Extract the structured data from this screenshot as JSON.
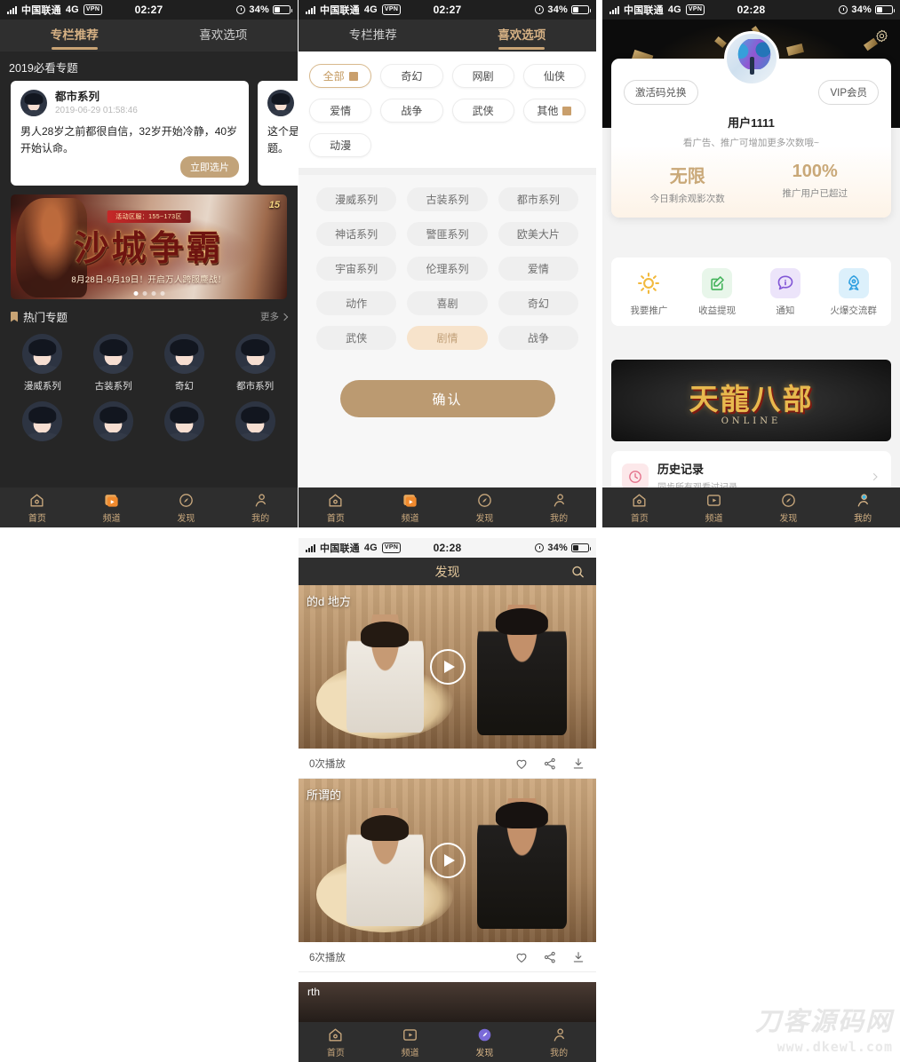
{
  "watermark": {
    "cn": "刀客源码网",
    "en": "www.dkewl.com"
  },
  "phone1": {
    "status": {
      "carrier": "中国联通",
      "network": "4G",
      "vpn": "VPN",
      "time": "02:27",
      "battery": "34%"
    },
    "tabs": [
      {
        "label": "专栏推荐",
        "active": true
      },
      {
        "label": "喜欢选项",
        "active": false
      }
    ],
    "section_title": "2019必看专题",
    "cards": [
      {
        "name": "都市系列",
        "time": "2019-06-29 01:58:46",
        "desc": "男人28岁之前都很自信，32岁开始冷静，40岁开始认命。",
        "button": "立即选片"
      },
      {
        "name": "",
        "time": "",
        "desc": "这个是专题。",
        "button": ""
      }
    ],
    "banner": {
      "tagline": "活动区服：155~173区",
      "title": "沙城争霸",
      "subtitle": "8月28日-9月19日！开启万人跨服鏖战！",
      "logo": "15"
    },
    "hot": {
      "title": "热门专题",
      "more": "更多",
      "items": [
        {
          "label": "漫威系列"
        },
        {
          "label": "古装系列"
        },
        {
          "label": "奇幻"
        },
        {
          "label": "都市系列"
        },
        {
          "label": ""
        },
        {
          "label": ""
        },
        {
          "label": ""
        },
        {
          "label": ""
        }
      ]
    },
    "nav": [
      {
        "label": "首页",
        "icon": "home-icon",
        "active": true
      },
      {
        "label": "频道",
        "icon": "channel-icon",
        "active": false
      },
      {
        "label": "发现",
        "icon": "compass-icon",
        "active": false
      },
      {
        "label": "我的",
        "icon": "person-icon",
        "active": false
      }
    ]
  },
  "phone2": {
    "status": {
      "carrier": "中国联通",
      "network": "4G",
      "vpn": "VPN",
      "time": "02:27",
      "battery": "34%"
    },
    "tabs": [
      {
        "label": "专栏推荐",
        "active": false
      },
      {
        "label": "喜欢选项",
        "active": true
      }
    ],
    "top_pills": [
      {
        "label": "全部",
        "selected": true,
        "swatch": true
      },
      {
        "label": "奇幻",
        "selected": false,
        "swatch": false
      },
      {
        "label": "网剧",
        "selected": false,
        "swatch": false
      },
      {
        "label": "仙侠",
        "selected": false,
        "swatch": false
      },
      {
        "label": "爱情",
        "selected": false,
        "swatch": false
      },
      {
        "label": "战争",
        "selected": false,
        "swatch": false
      },
      {
        "label": "武侠",
        "selected": false,
        "swatch": false
      },
      {
        "label": "其他",
        "selected": false,
        "swatch": true
      },
      {
        "label": "动漫",
        "selected": false,
        "swatch": false
      }
    ],
    "tag_pills": [
      {
        "label": "漫威系列",
        "selected": false
      },
      {
        "label": "古装系列",
        "selected": false
      },
      {
        "label": "都市系列",
        "selected": false
      },
      {
        "label": "神话系列",
        "selected": false
      },
      {
        "label": "警匪系列",
        "selected": false
      },
      {
        "label": "欧美大片",
        "selected": false
      },
      {
        "label": "宇宙系列",
        "selected": false
      },
      {
        "label": "伦理系列",
        "selected": false
      },
      {
        "label": "爱情",
        "selected": false
      },
      {
        "label": "动作",
        "selected": false
      },
      {
        "label": "喜剧",
        "selected": false
      },
      {
        "label": "奇幻",
        "selected": false
      },
      {
        "label": "武侠",
        "selected": false
      },
      {
        "label": "剧情",
        "selected": true
      },
      {
        "label": "战争",
        "selected": false
      }
    ],
    "confirm_label": "确认",
    "nav": [
      {
        "label": "首页",
        "icon": "home-icon",
        "active": true
      },
      {
        "label": "频道",
        "icon": "channel-icon",
        "active": false
      },
      {
        "label": "发现",
        "icon": "compass-icon",
        "active": false
      },
      {
        "label": "我的",
        "icon": "person-icon",
        "active": false
      }
    ]
  },
  "phone3": {
    "status": {
      "carrier": "中国联通",
      "network": "4G",
      "vpn": "VPN",
      "time": "02:28",
      "battery": "34%"
    },
    "redeem_label": "激活码兑换",
    "vip_label": "VIP会员",
    "username": "用户1111",
    "tip": "看广告、推广可增加更多次数哦~",
    "stats": [
      {
        "value": "无限",
        "caption": "今日剩余观影次数"
      },
      {
        "value": "100%",
        "caption": "推广用户已超过"
      }
    ],
    "quick": [
      {
        "label": "我要推广",
        "icon": "sun-icon",
        "bg": "#ffffff"
      },
      {
        "label": "收益提现",
        "icon": "edit-square-icon",
        "bg": "#e8f6ea"
      },
      {
        "label": "通知",
        "icon": "info-bubble-icon",
        "bg": "#ece4fa"
      },
      {
        "label": "火爆交流群",
        "icon": "rocket-icon",
        "bg": "#dcf0fb"
      }
    ],
    "banner": {
      "title": "天龍八部",
      "subtitle": "ONLINE"
    },
    "history": {
      "title": "历史记录",
      "subtitle": "同步所有观看过记录"
    },
    "nav": [
      {
        "label": "首页",
        "icon": "home-icon",
        "active": false
      },
      {
        "label": "频道",
        "icon": "channel-icon",
        "active": false
      },
      {
        "label": "发现",
        "icon": "compass-icon",
        "active": false
      },
      {
        "label": "我的",
        "icon": "person-icon",
        "active": true
      }
    ]
  },
  "phone4": {
    "status": {
      "carrier": "中国联通",
      "network": "4G",
      "vpn": "VPN",
      "time": "02:28",
      "battery": "34%"
    },
    "title": "发现",
    "search_icon": "search-icon",
    "videos": [
      {
        "caption": "的d 地方",
        "plays": "0次播放"
      },
      {
        "caption": "所谓的",
        "plays": "6次播放"
      },
      {
        "caption": "rth",
        "plays": ""
      }
    ],
    "actions": [
      {
        "icon": "heart-icon"
      },
      {
        "icon": "share-icon"
      },
      {
        "icon": "download-icon"
      }
    ],
    "nav": [
      {
        "label": "首页",
        "icon": "home-icon",
        "active": false
      },
      {
        "label": "频道",
        "icon": "channel-icon",
        "active": false
      },
      {
        "label": "发现",
        "icon": "compass-icon",
        "active": true
      },
      {
        "label": "我的",
        "icon": "person-icon",
        "active": false
      }
    ]
  },
  "colors": {
    "accent": "#c8a374",
    "dark_bg": "#262626",
    "nav_bg": "#2e2e2e",
    "selected_pill": "#f7e3cb"
  }
}
